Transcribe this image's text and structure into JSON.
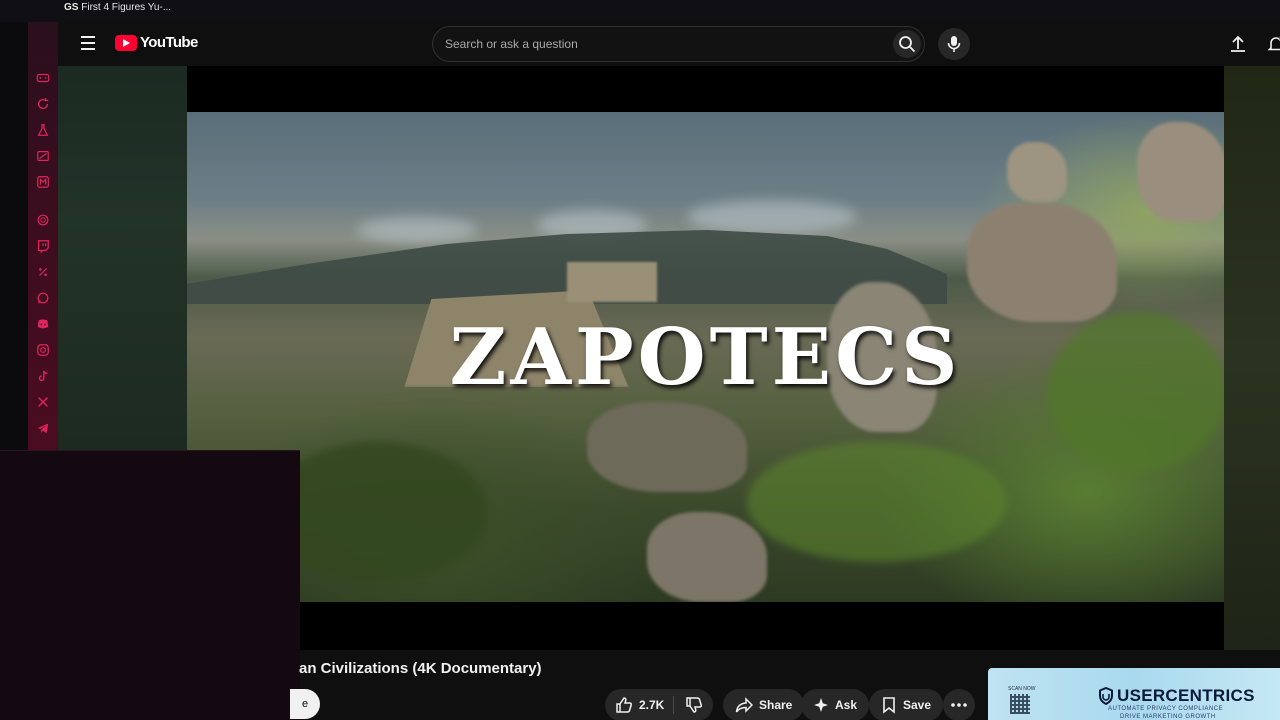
{
  "browser": {
    "tab_icon_text": "GS",
    "tab_title": "First 4 Figures Yu-..."
  },
  "sidebar": {
    "items": [
      {
        "icon": "gamepad-icon"
      },
      {
        "icon": "refresh-icon"
      },
      {
        "icon": "flask-icon"
      },
      {
        "icon": "card-icon"
      },
      {
        "icon": "m-square-icon"
      },
      {
        "icon": "openai-icon"
      },
      {
        "icon": "twitch-icon"
      },
      {
        "icon": "percent-icon"
      },
      {
        "icon": "whatsapp-icon"
      },
      {
        "icon": "discord-icon"
      },
      {
        "icon": "instagram-icon"
      },
      {
        "icon": "tiktok-icon"
      },
      {
        "icon": "x-icon"
      },
      {
        "icon": "telegram-icon"
      }
    ]
  },
  "header": {
    "logo_text": "YouTube",
    "search_placeholder": "Search or ask a question"
  },
  "player": {
    "overlay_title": "ZAPOTECS"
  },
  "video": {
    "title": "an Civilizations (4K Documentary)",
    "subscribe_partial": "e"
  },
  "actions": {
    "likes": "2.7K",
    "share_label": "Share",
    "ask_label": "Ask",
    "save_label": "Save"
  },
  "ad": {
    "brand": "USERCENTRICS",
    "qr_label": "SCAN NOW",
    "tagline": "AUTOMATE PRIVACY COMPLIANCE",
    "tagline2": "DRIVE MARKETING GROWTH"
  },
  "colors": {
    "background": "#0f0f0f",
    "accent_red": "#ff0033",
    "sidebar_gradient_end": "#4b0c21",
    "icon_pink": "#e0245e"
  }
}
